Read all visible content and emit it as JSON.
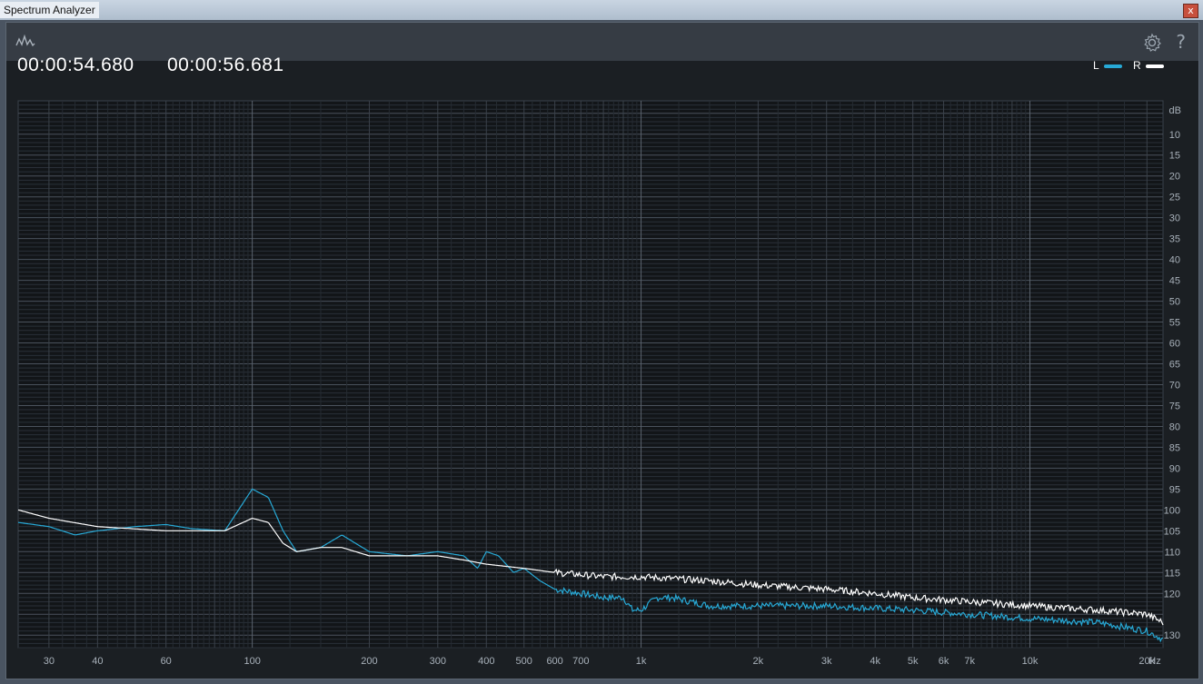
{
  "window": {
    "title": "Spectrum Analyzer",
    "close_label": "x"
  },
  "toolbar": {
    "logo_icon": "waveform-icon",
    "settings_icon": "gear-icon",
    "help_label": "?"
  },
  "time_range": {
    "start": "00:00:54.680",
    "end": "00:00:56.681"
  },
  "legend": [
    {
      "label": "L",
      "color": "#27a9d6"
    },
    {
      "label": "R",
      "color": "#ffffff"
    }
  ],
  "chart_data": {
    "type": "line",
    "x_scale": "log",
    "xlabel": "Hz",
    "ylabel": "dB",
    "xlim": [
      25,
      22000
    ],
    "ylim": [
      -133,
      -2
    ],
    "x_ticks": [
      {
        "v": 30,
        "label": "30"
      },
      {
        "v": 40,
        "label": "40"
      },
      {
        "v": 60,
        "label": "60"
      },
      {
        "v": 100,
        "label": "100"
      },
      {
        "v": 200,
        "label": "200"
      },
      {
        "v": 300,
        "label": "300"
      },
      {
        "v": 400,
        "label": "400"
      },
      {
        "v": 500,
        "label": "500"
      },
      {
        "v": 600,
        "label": "600"
      },
      {
        "v": 700,
        "label": "700"
      },
      {
        "v": 1000,
        "label": "1k"
      },
      {
        "v": 2000,
        "label": "2k"
      },
      {
        "v": 3000,
        "label": "3k"
      },
      {
        "v": 4000,
        "label": "4k"
      },
      {
        "v": 5000,
        "label": "5k"
      },
      {
        "v": 6000,
        "label": "6k"
      },
      {
        "v": 7000,
        "label": "7k"
      },
      {
        "v": 10000,
        "label": "10k"
      },
      {
        "v": 20000,
        "label": "20k"
      }
    ],
    "y_ticks": [
      -10,
      -15,
      -20,
      -25,
      -30,
      -35,
      -40,
      -45,
      -50,
      -55,
      -60,
      -65,
      -70,
      -75,
      -80,
      -85,
      -90,
      -95,
      -100,
      -105,
      -110,
      -115,
      -120,
      -130
    ],
    "series": [
      {
        "name": "L",
        "color": "#27a9d6",
        "points": [
          [
            25,
            -103
          ],
          [
            30,
            -104
          ],
          [
            35,
            -106
          ],
          [
            40,
            -105
          ],
          [
            50,
            -104
          ],
          [
            60,
            -103.5
          ],
          [
            70,
            -104.5
          ],
          [
            85,
            -105
          ],
          [
            100,
            -95
          ],
          [
            110,
            -97
          ],
          [
            120,
            -105
          ],
          [
            130,
            -110
          ],
          [
            150,
            -109
          ],
          [
            170,
            -106
          ],
          [
            200,
            -110
          ],
          [
            250,
            -111
          ],
          [
            300,
            -110
          ],
          [
            350,
            -111
          ],
          [
            380,
            -114
          ],
          [
            400,
            -110
          ],
          [
            430,
            -111
          ],
          [
            470,
            -115
          ],
          [
            500,
            -114
          ],
          [
            550,
            -117
          ],
          [
            600,
            -119
          ],
          [
            700,
            -120
          ],
          [
            800,
            -121
          ],
          [
            900,
            -121
          ],
          [
            950,
            -124
          ],
          [
            1000,
            -124
          ],
          [
            1100,
            -121
          ],
          [
            1200,
            -121
          ],
          [
            1500,
            -123
          ],
          [
            2000,
            -123
          ],
          [
            3000,
            -123
          ],
          [
            5000,
            -124
          ],
          [
            7000,
            -125
          ],
          [
            10000,
            -126
          ],
          [
            15000,
            -127
          ],
          [
            20000,
            -129
          ],
          [
            22000,
            -131
          ]
        ]
      },
      {
        "name": "R",
        "color": "#ffffff",
        "points": [
          [
            25,
            -100
          ],
          [
            30,
            -102
          ],
          [
            40,
            -104
          ],
          [
            60,
            -105
          ],
          [
            70,
            -105
          ],
          [
            85,
            -105
          ],
          [
            100,
            -102
          ],
          [
            110,
            -103
          ],
          [
            120,
            -108
          ],
          [
            130,
            -110
          ],
          [
            150,
            -109
          ],
          [
            170,
            -109
          ],
          [
            200,
            -111
          ],
          [
            300,
            -111
          ],
          [
            350,
            -112
          ],
          [
            400,
            -113
          ],
          [
            500,
            -114
          ],
          [
            600,
            -115
          ],
          [
            800,
            -116
          ],
          [
            1000,
            -116
          ],
          [
            1500,
            -117
          ],
          [
            2000,
            -118
          ],
          [
            3000,
            -119
          ],
          [
            4000,
            -120
          ],
          [
            5000,
            -121
          ],
          [
            7000,
            -122
          ],
          [
            10000,
            -123
          ],
          [
            15000,
            -124
          ],
          [
            20000,
            -125
          ],
          [
            22000,
            -127
          ]
        ]
      }
    ]
  }
}
